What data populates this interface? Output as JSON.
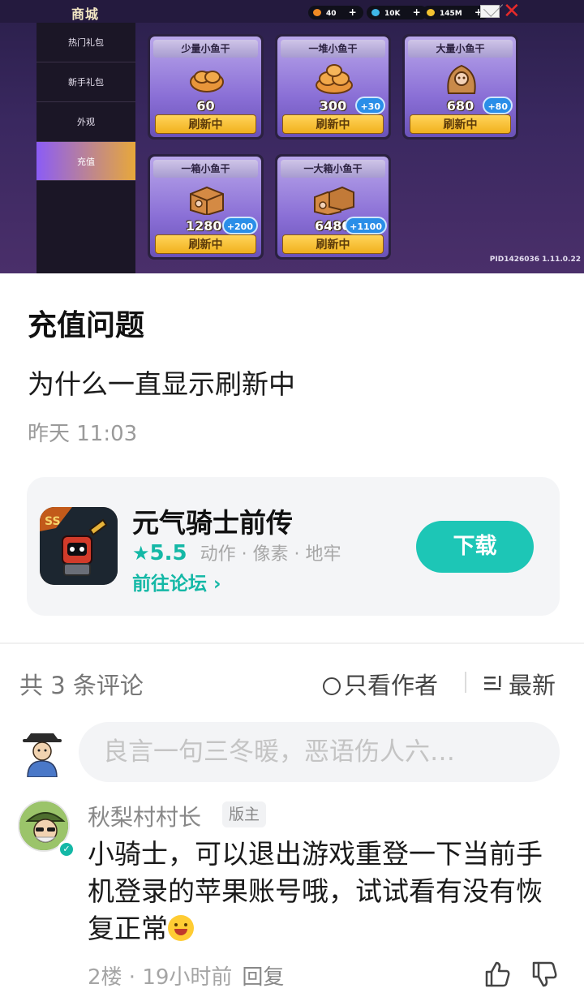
{
  "game_screen": {
    "shop_title": "商城",
    "resources": [
      {
        "name": "fish",
        "value": "40",
        "color": "#f08a24"
      },
      {
        "name": "gems",
        "value": "10K",
        "color": "#3fb7e8"
      },
      {
        "name": "coins",
        "value": "145M",
        "color": "#f2c230"
      }
    ],
    "plus": "+",
    "sidebar": [
      "热门礼包",
      "新手礼包",
      "外观",
      "充值"
    ],
    "cards": [
      {
        "title": "少量小鱼干",
        "amount": "60",
        "bonus": "",
        "button": "刷新中"
      },
      {
        "title": "一堆小鱼干",
        "amount": "300",
        "bonus": "+30",
        "button": "刷新中"
      },
      {
        "title": "大量小鱼干",
        "amount": "680",
        "bonus": "+80",
        "button": "刷新中"
      },
      {
        "title": "一箱小鱼干",
        "amount": "1280",
        "bonus": "+200",
        "button": "刷新中"
      },
      {
        "title": "一大箱小鱼干",
        "amount": "6480",
        "bonus": "+1100",
        "button": "刷新中"
      }
    ],
    "pid": "PID1426036 1.11.0.22"
  },
  "post": {
    "title": "充值问题",
    "body": "为什么一直显示刷新中",
    "time": "昨天 11:03"
  },
  "game_card": {
    "name": "元气骑士前传",
    "star": "★",
    "rating": "5.5",
    "tags": "动作 · 像素 · 地牢",
    "forum_link": "前往论坛 ›",
    "download": "下载"
  },
  "comments_header": {
    "count": "共 3 条评论",
    "only_author": "只看作者",
    "sort": "最新"
  },
  "comment_input": {
    "placeholder": "良言一句三冬暖，恶语伤人六…"
  },
  "comment": {
    "author": "秋梨村村长",
    "badge": "版主",
    "text": "小骑士，可以退出游戏重登一下当前手机登录的苹果账号哦，试试看有没有恢复正常",
    "meta": "2楼 · 19小时前",
    "reply": "回复"
  }
}
